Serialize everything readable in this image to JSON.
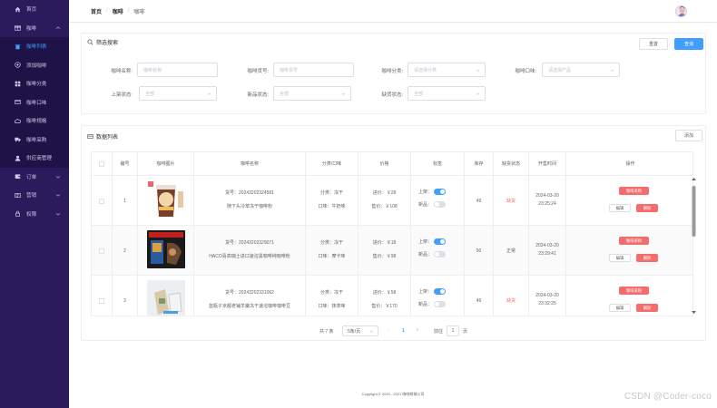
{
  "sidebar": {
    "items": [
      {
        "label": "首页",
        "icon": "home-icon"
      },
      {
        "label": "咖啡",
        "icon": "gift-icon"
      },
      {
        "label": "咖啡列表",
        "icon": "trash-icon"
      },
      {
        "label": "添加咖啡",
        "icon": "circle-plus-icon"
      },
      {
        "label": "咖啡分类",
        "icon": "grid-icon"
      },
      {
        "label": "咖啡口味",
        "icon": "folder-icon"
      },
      {
        "label": "咖啡规格",
        "icon": "cloud-icon"
      },
      {
        "label": "咖啡采购",
        "icon": "truck-icon"
      },
      {
        "label": "供应商管理",
        "icon": "user-icon"
      },
      {
        "label": "订单",
        "icon": "wallet-icon"
      },
      {
        "label": "营销",
        "icon": "tickets-icon"
      },
      {
        "label": "权限",
        "icon": "lock-icon"
      }
    ]
  },
  "header": {
    "breadcrumb": [
      "首页",
      "咖啡",
      "咖啡"
    ]
  },
  "filter": {
    "title": "筛选搜索",
    "reset_label": "重置",
    "query_label": "查询",
    "fields": [
      {
        "label": "咖啡名称:",
        "placeholder": "咖啡名称"
      },
      {
        "label": "咖啡货号:",
        "placeholder": "咖啡货号"
      },
      {
        "label": "咖啡分类:",
        "placeholder": "请选择分类"
      },
      {
        "label": "咖啡口味:",
        "placeholder": "请选择产品"
      },
      {
        "label": "上架状态:",
        "placeholder": "全部"
      },
      {
        "label": "新品状态:",
        "placeholder": "全部"
      },
      {
        "label": "缺货状态:",
        "placeholder": "全部"
      }
    ]
  },
  "table": {
    "title": "数据列表",
    "add_label": "添加",
    "columns": [
      "编号",
      "咖啡图片",
      "咖啡名称",
      "分类/口味",
      "价格",
      "标签",
      "库存",
      "缺货状态",
      "开售时间",
      "操作"
    ],
    "rows": [
      {
        "id": "1",
        "sku": "货号：20243202324581",
        "name": "随下头冷萃冻干咖啡粉",
        "category": "分类：冻干",
        "flavor": "口味：牛奶味",
        "in_price": "进价：￥28",
        "sale_price": "售价：￥108",
        "shelf_label": "上架：",
        "new_label": "新品：",
        "shelf_on": true,
        "new_on": false,
        "stock": "49",
        "stock_status": "缺货",
        "date": "2024-03-20",
        "time": "23:25:24",
        "purchase_label": "咖啡采购",
        "edit_label": "编辑",
        "delete_label": "删除"
      },
      {
        "id": "2",
        "sku": "货号：20243202329071",
        "name": "HACO喜高瑞士进口速溶黑咖啡纯咖啡粉",
        "category": "分类：冻干",
        "flavor": "口味：摩卡味",
        "in_price": "进价：￥18",
        "sale_price": "售价：￥98",
        "shelf_label": "上架：",
        "new_label": "新品：",
        "shelf_on": true,
        "new_on": false,
        "stock": "50",
        "stock_status": "正常",
        "date": "2024-03-20",
        "time": "23:29:41",
        "purchase_label": "咖啡采购",
        "edit_label": "编辑",
        "delete_label": "删除"
      },
      {
        "id": "3",
        "sku": "货号：20243202331062",
        "name": "蓝瓶子京都老铺羊羹冻干速溶咖啡咖啡豆",
        "category": "分类：冻干",
        "flavor": "口味：抹茶味",
        "in_price": "进价：￥58",
        "sale_price": "售价：￥170",
        "shelf_label": "上架：",
        "new_label": "新品：",
        "shelf_on": true,
        "new_on": false,
        "stock": "49",
        "stock_status": "缺货",
        "date": "2024-03-20",
        "time": "23:32:25",
        "purchase_label": "咖啡采购",
        "edit_label": "编辑",
        "delete_label": "删除"
      }
    ]
  },
  "pagination": {
    "total": "共 7 条",
    "page_size": "5条/页",
    "current": "1",
    "goto_label": "前往",
    "goto_value": "1",
    "page_suffix": "页"
  },
  "footer": {
    "copyright": "Copyright © 2020 - 2021  咖啡商城公司"
  },
  "watermark": "CSDN @Coder-coco",
  "colors": {
    "sidebar_bg": "#2b1a5c",
    "primary": "#409eff",
    "danger": "#f56c6c"
  }
}
